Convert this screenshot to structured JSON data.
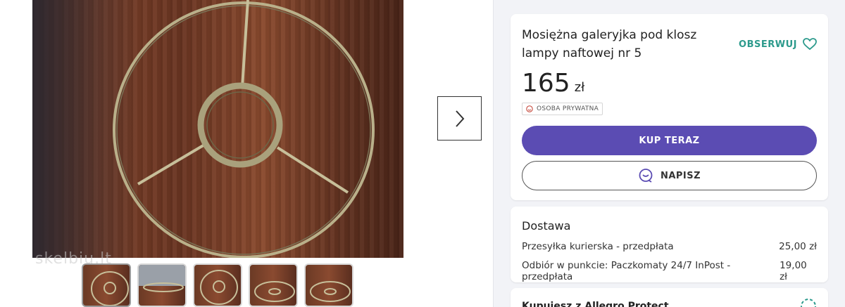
{
  "gallery": {
    "watermark": "skelbiu.lt",
    "thumbnails": [
      "thumb-1",
      "thumb-2",
      "thumb-3",
      "thumb-4",
      "thumb-5"
    ]
  },
  "offer": {
    "title": "Mosiężna galeryjka pod klosz lampy naftowej nr 5",
    "watch_label": "OBSERWUJ",
    "price_value": "165",
    "price_currency": "zł",
    "seller_badge": "OSOBA PRYWATNA",
    "buy_label": "KUP TERAZ",
    "write_label": "NAPISZ"
  },
  "delivery": {
    "title": "Dostawa",
    "options": [
      {
        "name": "Przesyłka kurierska - przedpłata",
        "price": "25,00 zł"
      },
      {
        "name": "Odbiór w punkcie: Paczkomaty 24/7 InPost - przedpłata",
        "price": "19,00 zł"
      }
    ]
  },
  "protect": {
    "title": "Kupujesz z Allegro Protect"
  },
  "colors": {
    "accent": "#5b4cb3",
    "watch": "#2c9a8c"
  }
}
